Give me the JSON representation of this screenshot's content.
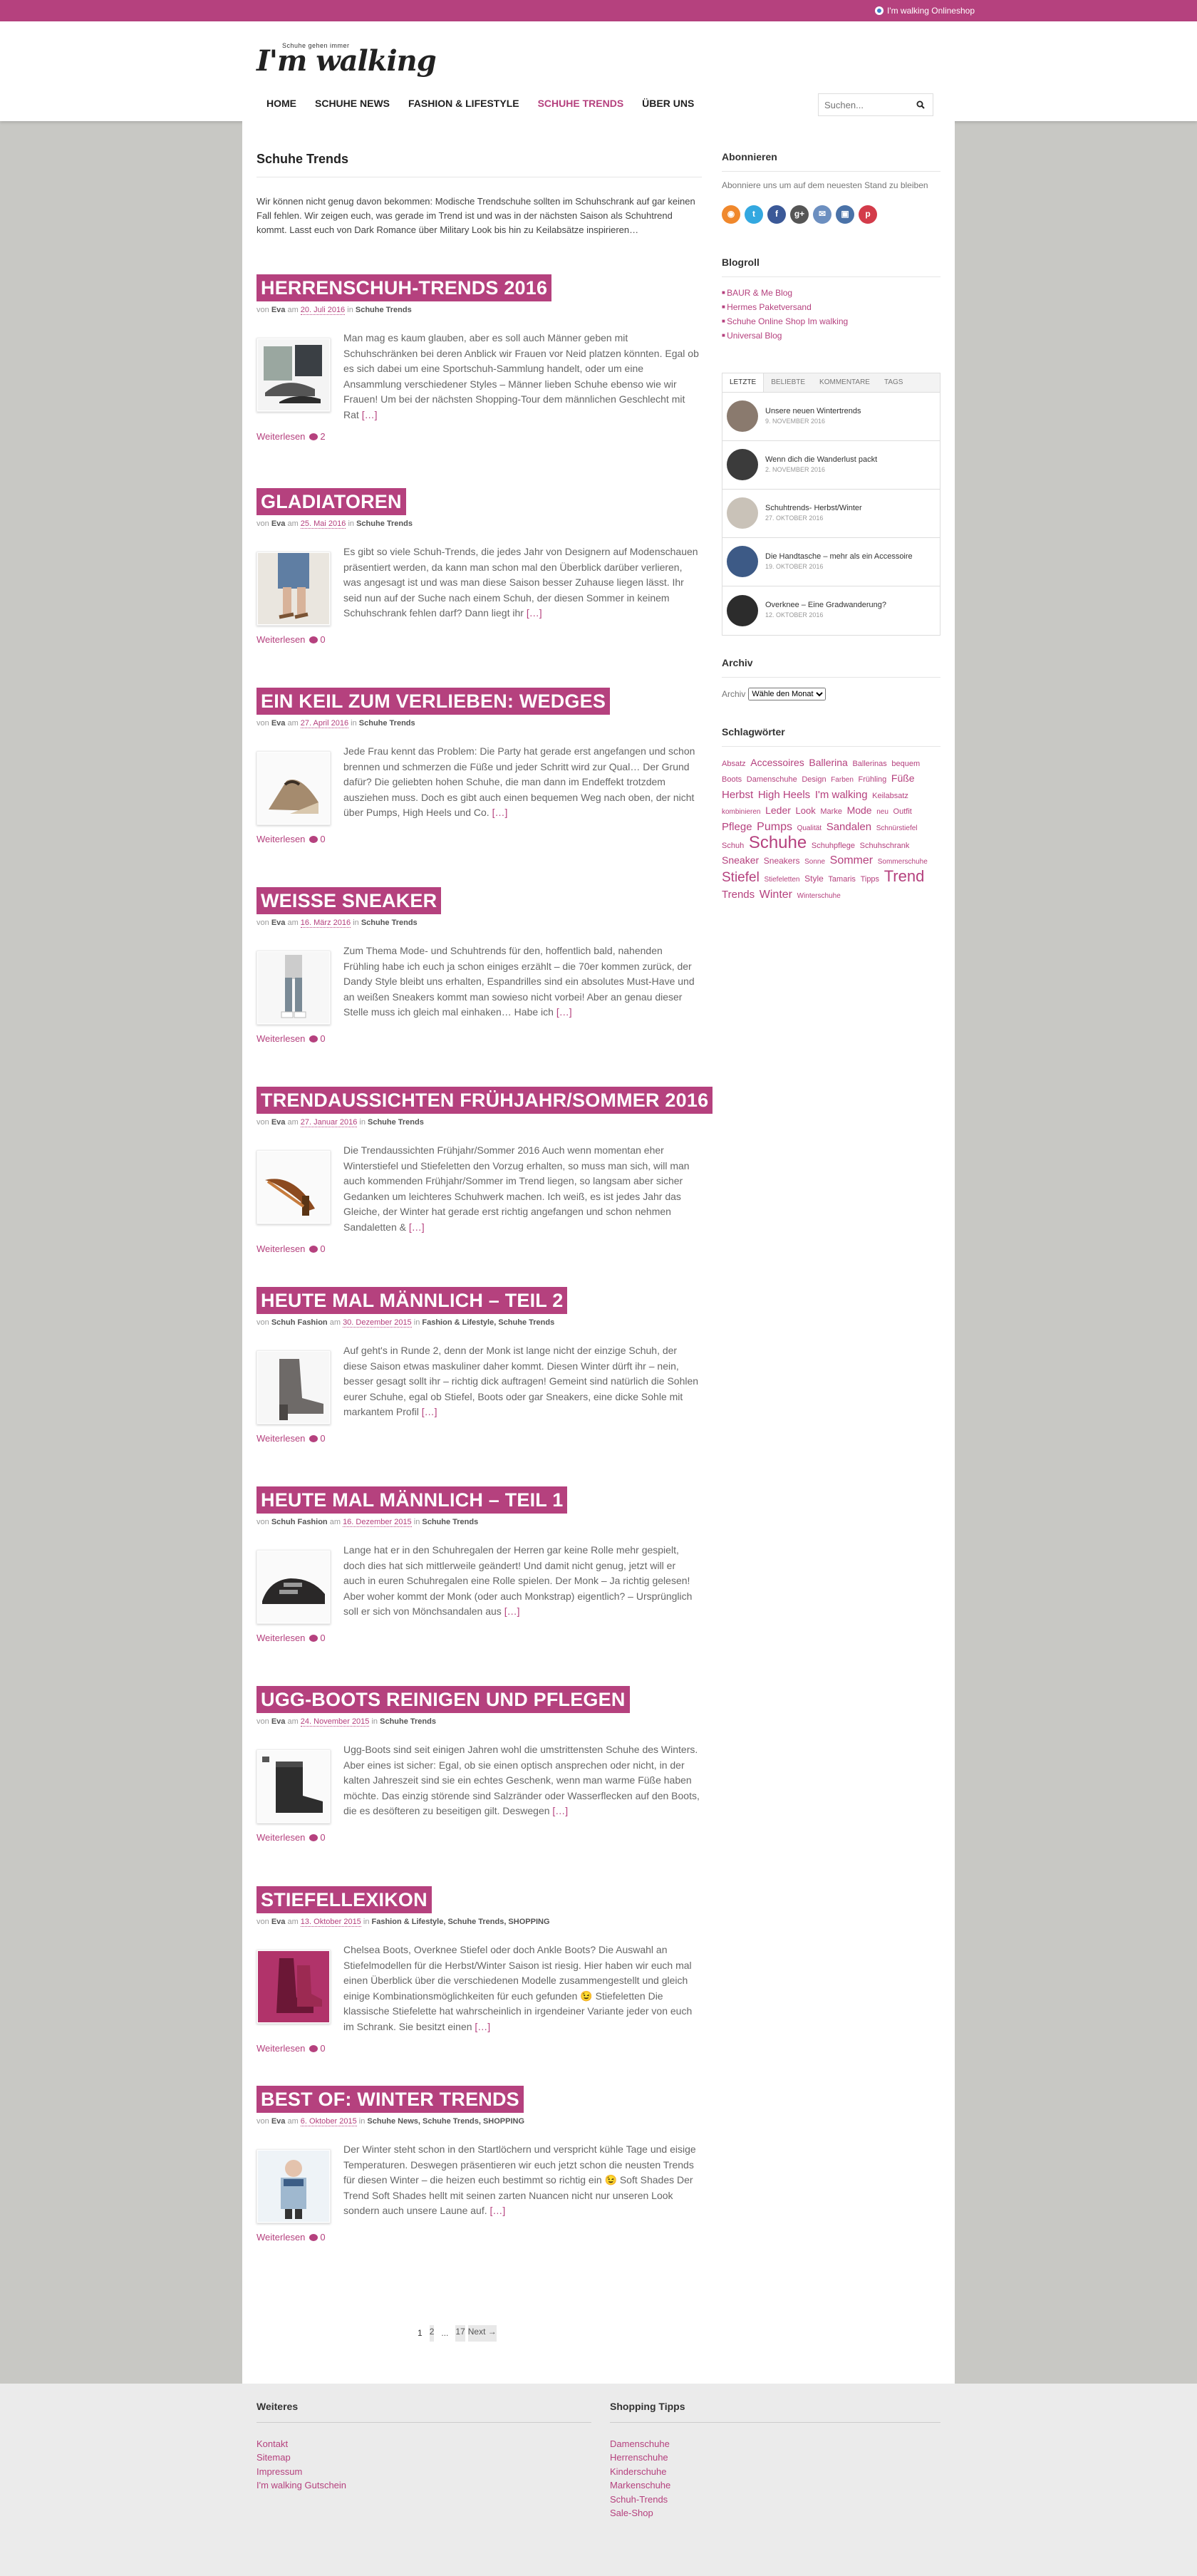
{
  "topbar": {
    "shop_link": "I'm walking Onlineshop"
  },
  "header": {
    "logo_tagline": "Schuhe gehen immer",
    "logo_name": "I'm walking"
  },
  "nav": {
    "items": [
      {
        "label": "HOME",
        "active": false
      },
      {
        "label": "SCHUHE NEWS",
        "active": false
      },
      {
        "label": "FASHION & LIFESTYLE",
        "active": false
      },
      {
        "label": "SCHUHE TRENDS",
        "active": true
      },
      {
        "label": "ÜBER UNS",
        "active": false
      }
    ]
  },
  "search": {
    "placeholder": "Suchen..."
  },
  "content": {
    "title": "Schuhe Trends",
    "intro": "Wir können nicht genug davon bekommen: Modische Trendschuhe sollten im Schuhschrank auf gar keinen Fall fehlen. Wir zeigen euch, was gerade im Trend ist und was in der nächsten Saison als Schuhtrend kommt. Lasst euch von Dark Romance über Military Look bis hin zu Keilabsätze inspirieren…",
    "posts": [
      {
        "title": "HERRENSCHUH-TRENDS 2016",
        "meta_von": "von",
        "author": "Eva",
        "meta_am": "am",
        "date": "20. Juli 2016",
        "meta_in": "in",
        "cats": "Schuhe Trends",
        "excerpt": "Man mag es kaum glauben, aber es soll auch Männer geben mit Schuhschränken bei deren Anblick wir Frauen vor Neid platzen könnten. Egal ob es sich dabei um eine Sportschuh-Sammlung handelt, oder um eine Ansammlung verschiedener Styles – Männer lieben Schuhe ebenso wie wir Frauen! Um bei der nächsten Shopping-Tour dem männlichen Geschlecht mit Rat",
        "more": "[…]",
        "readmore": "Weiterlesen",
        "comments": "2",
        "thumb": "shoes-men"
      },
      {
        "title": "GLADIATOREN",
        "meta_von": "von",
        "author": "Eva",
        "meta_am": "am",
        "date": "25. Mai 2016",
        "meta_in": "in",
        "cats": "Schuhe Trends",
        "excerpt": "Es gibt so viele Schuh-Trends, die jedes Jahr von Designern auf Modenschauen präsentiert werden, da kann man schon mal den Überblick darüber verlieren, was angesagt ist und was man diese Saison besser Zuhause liegen lässt. Ihr seid nun auf der Suche nach einem Schuh, der diesen Sommer in keinem Schuhschrank fehlen darf? Dann liegt ihr",
        "more": "[…]",
        "readmore": "Weiterlesen",
        "comments": "0",
        "thumb": "gladiator"
      },
      {
        "title": "EIN KEIL ZUM VERLIEBEN: WEDGES",
        "meta_von": "von",
        "author": "Eva",
        "meta_am": "am",
        "date": "27. April 2016",
        "meta_in": "in",
        "cats": "Schuhe Trends",
        "excerpt": "Jede Frau kennt das Problem: Die Party hat gerade erst angefangen und schon brennen und schmerzen die Füße und jeder Schritt wird zur Qual… Der Grund dafür? Die geliebten hohen Schuhe, die man dann im Endeffekt trotzdem ausziehen muss. Doch es gibt auch einen bequemen Weg nach oben, der nicht über Pumps, High Heels und Co.",
        "more": "[…]",
        "readmore": "Weiterlesen",
        "comments": "0",
        "thumb": "wedge"
      },
      {
        "title": "WEISSE SNEAKER",
        "meta_von": "von",
        "author": "Eva",
        "meta_am": "am",
        "date": "16. März 2016",
        "meta_in": "in",
        "cats": "Schuhe Trends",
        "excerpt": "Zum Thema Mode- und Schuhtrends für den, hoffentlich bald, nahenden Frühling habe ich euch ja schon einiges erzählt – die 70er kommen zurück, der Dandy Style bleibt uns erhalten, Espandrilles sind ein absolutes Must-Have und an weißen Sneakers kommt man sowieso nicht vorbei! Aber an genau dieser Stelle muss ich gleich mal einhaken… Habe ich",
        "more": "[…]",
        "readmore": "Weiterlesen",
        "comments": "0",
        "thumb": "sneaker"
      },
      {
        "title": "TRENDAUSSICHTEN FRÜHJAHR/SOMMER 2016",
        "meta_von": "von",
        "author": "Eva",
        "meta_am": "am",
        "date": "27. Januar 2016",
        "meta_in": "in",
        "cats": "Schuhe Trends",
        "excerpt": "Die Trendaussichten Frühjahr/Sommer 2016 Auch wenn momentan eher Winterstiefel und Stiefeletten den Vorzug erhalten, so muss man sich, will man auch  kommenden Frühjahr/Sommer im Trend liegen, so langsam aber sicher Gedanken um leichteres Schuhwerk machen. Ich weiß, es ist jedes Jahr das Gleiche, der Winter hat gerade erst richtig angefangen und schon nehmen Sandaletten &",
        "more": "[…]",
        "readmore": "Weiterlesen",
        "comments": "0",
        "thumb": "sandal"
      },
      {
        "title": "HEUTE MAL MÄNNLICH – TEIL 2",
        "meta_von": "von",
        "author": "Schuh Fashion",
        "meta_am": "am",
        "date": "30. Dezember 2015",
        "meta_in": "in",
        "cats": "Fashion & Lifestyle, Schuhe Trends",
        "excerpt": "Auf geht's in Runde 2, denn der Monk ist lange nicht der einzige Schuh, der diese Saison etwas maskuliner daher kommt. Diesen Winter dürft ihr – nein, besser gesagt sollt ihr – richtig dick auftragen! Gemeint sind natürlich die Sohlen eurer Schuhe, egal ob Stiefel, Boots oder gar Sneakers, eine dicke Sohle mit markantem Profil",
        "more": "[…]",
        "readmore": "Weiterlesen",
        "comments": "0",
        "thumb": "boot-grey"
      },
      {
        "title": "HEUTE MAL MÄNNLICH – TEIL 1",
        "meta_von": "von",
        "author": "Schuh Fashion",
        "meta_am": "am",
        "date": "16. Dezember 2015",
        "meta_in": "in",
        "cats": "Schuhe Trends",
        "excerpt": "Lange hat er in den Schuhregalen der Herren gar keine Rolle mehr gespielt, doch dies hat sich mittlerweile geändert! Und damit nicht genug, jetzt will er auch in euren Schuhregalen eine Rolle spielen. Der Monk – Ja richtig gelesen! Aber woher kommt der Monk (oder auch Monkstrap) eigentlich? – Ursprünglich soll er sich von Mönchsandalen aus",
        "more": "[…]",
        "readmore": "Weiterlesen",
        "comments": "0",
        "thumb": "monk"
      },
      {
        "title": "UGG-BOOTS REINIGEN UND PFLEGEN",
        "meta_von": "von",
        "author": "Eva",
        "meta_am": "am",
        "date": "24. November 2015",
        "meta_in": "in",
        "cats": "Schuhe Trends",
        "excerpt": "Ugg-Boots sind seit einigen Jahren wohl die umstrittensten Schuhe des Winters. Aber eines ist sicher: Egal, ob sie einen optisch ansprechen oder nicht, in der kalten Jahreszeit sind sie ein echtes Geschenk, wenn man warme Füße haben möchte. Das einzig störende sind Salzränder oder Wasserflecken auf den Boots, die es desöfteren zu beseitigen gilt. Deswegen",
        "more": "[…]",
        "readmore": "Weiterlesen",
        "comments": "0",
        "thumb": "ugg"
      },
      {
        "title": "STIEFELLEXIKON",
        "meta_von": "von",
        "author": "Eva",
        "meta_am": "am",
        "date": "13. Oktober 2015",
        "meta_in": "in",
        "cats": "Fashion & Lifestyle, Schuhe Trends, SHOPPING",
        "excerpt": "Chelsea Boots, Overknee Stiefel oder doch Ankle Boots? Die Auswahl an Stiefelmodellen für die Herbst/Winter Saison ist riesig. Hier haben wir euch mal einen Überblick über die verschiedenen Modelle zusammengestellt und gleich einige Kombinationsmöglichkeiten für euch gefunden 😉 Stiefeletten Die klassische Stiefelette hat wahrscheinlich in irgendeiner Variante jeder von euch im Schrank. Sie besitzt einen",
        "more": "[…]",
        "readmore": "Weiterlesen",
        "comments": "0",
        "thumb": "stiefel"
      },
      {
        "title": "BEST OF: WINTER TRENDS",
        "meta_von": "von",
        "author": "Eva",
        "meta_am": "am",
        "date": "6. Oktober 2015",
        "meta_in": "in",
        "cats": "Schuhe News, Schuhe Trends, SHOPPING",
        "excerpt": "Der Winter steht schon in den Startlöchern und verspricht kühle Tage und eisige Temperaturen. Deswegen präsentieren wir euch jetzt schon die neusten Trends für diesen Winter – die heizen euch bestimmt so richtig ein 😉 Soft Shades Der Trend Soft Shades hellt mit seinen zarten Nuancen nicht nur unseren Look sondern auch unsere Laune auf.",
        "more": "[…]",
        "readmore": "Weiterlesen",
        "comments": "0",
        "thumb": "winter"
      }
    ]
  },
  "pagination": {
    "p1": "1",
    "p2": "2",
    "dots": "...",
    "last": "17",
    "next": "Next →"
  },
  "sidebar": {
    "subscribe": {
      "title": "Abonnieren",
      "text": "Abonniere uns um auf dem neuesten Stand zu bleiben",
      "icons": [
        "rss-icon",
        "twitter-icon",
        "facebook-icon",
        "googleplus-icon",
        "email-icon",
        "instagram-icon",
        "pinterest-icon"
      ]
    },
    "blogroll": {
      "title": "Blogroll",
      "items": [
        "BAUR & Me Blog",
        "Hermes Paketversand",
        "Schuhe Online Shop Im walking",
        "Universal Blog"
      ]
    },
    "tabs": {
      "labels": [
        "LETZTE",
        "BELIEBTE",
        "KOMMENTARE",
        "TAGS"
      ],
      "items": [
        {
          "title": "Unsere neuen Wintertrends",
          "date": "9. NOVEMBER 2016"
        },
        {
          "title": "Wenn dich die Wanderlust packt",
          "date": "2. NOVEMBER 2016"
        },
        {
          "title": "Schuhtrends- Herbst/Winter",
          "date": "27. OKTOBER 2016"
        },
        {
          "title": "Die Handtasche – mehr als ein Accessoire",
          "date": "19. OKTOBER 2016"
        },
        {
          "title": "Overknee – Eine Gradwanderung?",
          "date": "12. OKTOBER 2016"
        }
      ]
    },
    "archive": {
      "title": "Archiv",
      "label": "Archiv",
      "select": "Wähle den Monat"
    },
    "tags": {
      "title": "Schlagwörter",
      "list": [
        {
          "t": "Absatz",
          "s": 11
        },
        {
          "t": "Accessoires",
          "s": 14
        },
        {
          "t": "Ballerina",
          "s": 14
        },
        {
          "t": "Ballerinas",
          "s": 11
        },
        {
          "t": "bequem",
          "s": 11
        },
        {
          "t": "Boots",
          "s": 11
        },
        {
          "t": "Damenschuhe",
          "s": 11
        },
        {
          "t": "Design",
          "s": 11
        },
        {
          "t": "Farben",
          "s": 10
        },
        {
          "t": "Frühling",
          "s": 11
        },
        {
          "t": "Füße",
          "s": 14
        },
        {
          "t": "Herbst",
          "s": 15
        },
        {
          "t": "High Heels",
          "s": 15
        },
        {
          "t": "I'm walking",
          "s": 15
        },
        {
          "t": "Keilabsatz",
          "s": 11
        },
        {
          "t": "kombinieren",
          "s": 10
        },
        {
          "t": "Leder",
          "s": 14
        },
        {
          "t": "Look",
          "s": 13
        },
        {
          "t": "Marke",
          "s": 11
        },
        {
          "t": "Mode",
          "s": 14
        },
        {
          "t": "neu",
          "s": 10
        },
        {
          "t": "Outfit",
          "s": 11
        },
        {
          "t": "Pflege",
          "s": 15
        },
        {
          "t": "Pumps",
          "s": 16
        },
        {
          "t": "Qualität",
          "s": 10
        },
        {
          "t": "Sandalen",
          "s": 15
        },
        {
          "t": "Schnürstiefel",
          "s": 10
        },
        {
          "t": "Schuh",
          "s": 11
        },
        {
          "t": "Schuhe",
          "s": 24
        },
        {
          "t": "Schuhpflege",
          "s": 11
        },
        {
          "t": "Schuhschrank",
          "s": 11
        },
        {
          "t": "Sneaker",
          "s": 14
        },
        {
          "t": "Sneakers",
          "s": 12
        },
        {
          "t": "Sonne",
          "s": 10
        },
        {
          "t": "Sommer",
          "s": 16
        },
        {
          "t": "Sommerschuhe",
          "s": 10
        },
        {
          "t": "Stiefel",
          "s": 19
        },
        {
          "t": "Stiefeletten",
          "s": 10
        },
        {
          "t": "Style",
          "s": 12
        },
        {
          "t": "Tamaris",
          "s": 11
        },
        {
          "t": "Tipps",
          "s": 11
        },
        {
          "t": "Trend",
          "s": 22
        },
        {
          "t": "Trends",
          "s": 15
        },
        {
          "t": "Winter",
          "s": 16
        },
        {
          "t": "Winterschuhe",
          "s": 10
        }
      ]
    }
  },
  "footer": {
    "col1": {
      "title": "Weiteres",
      "links": [
        "Kontakt",
        "Sitemap",
        "Impressum",
        "I'm walking Gutschein"
      ]
    },
    "col2": {
      "title": "Shopping Tipps",
      "links": [
        "Damenschuhe",
        "Herrenschuhe",
        "Kinderschuhe",
        "Markenschuhe",
        "Schuh-Trends",
        "Sale-Shop"
      ]
    }
  },
  "colors": {
    "accent": "#b5417e",
    "background": "#c8c8c4",
    "footer": "#ebebeb"
  }
}
